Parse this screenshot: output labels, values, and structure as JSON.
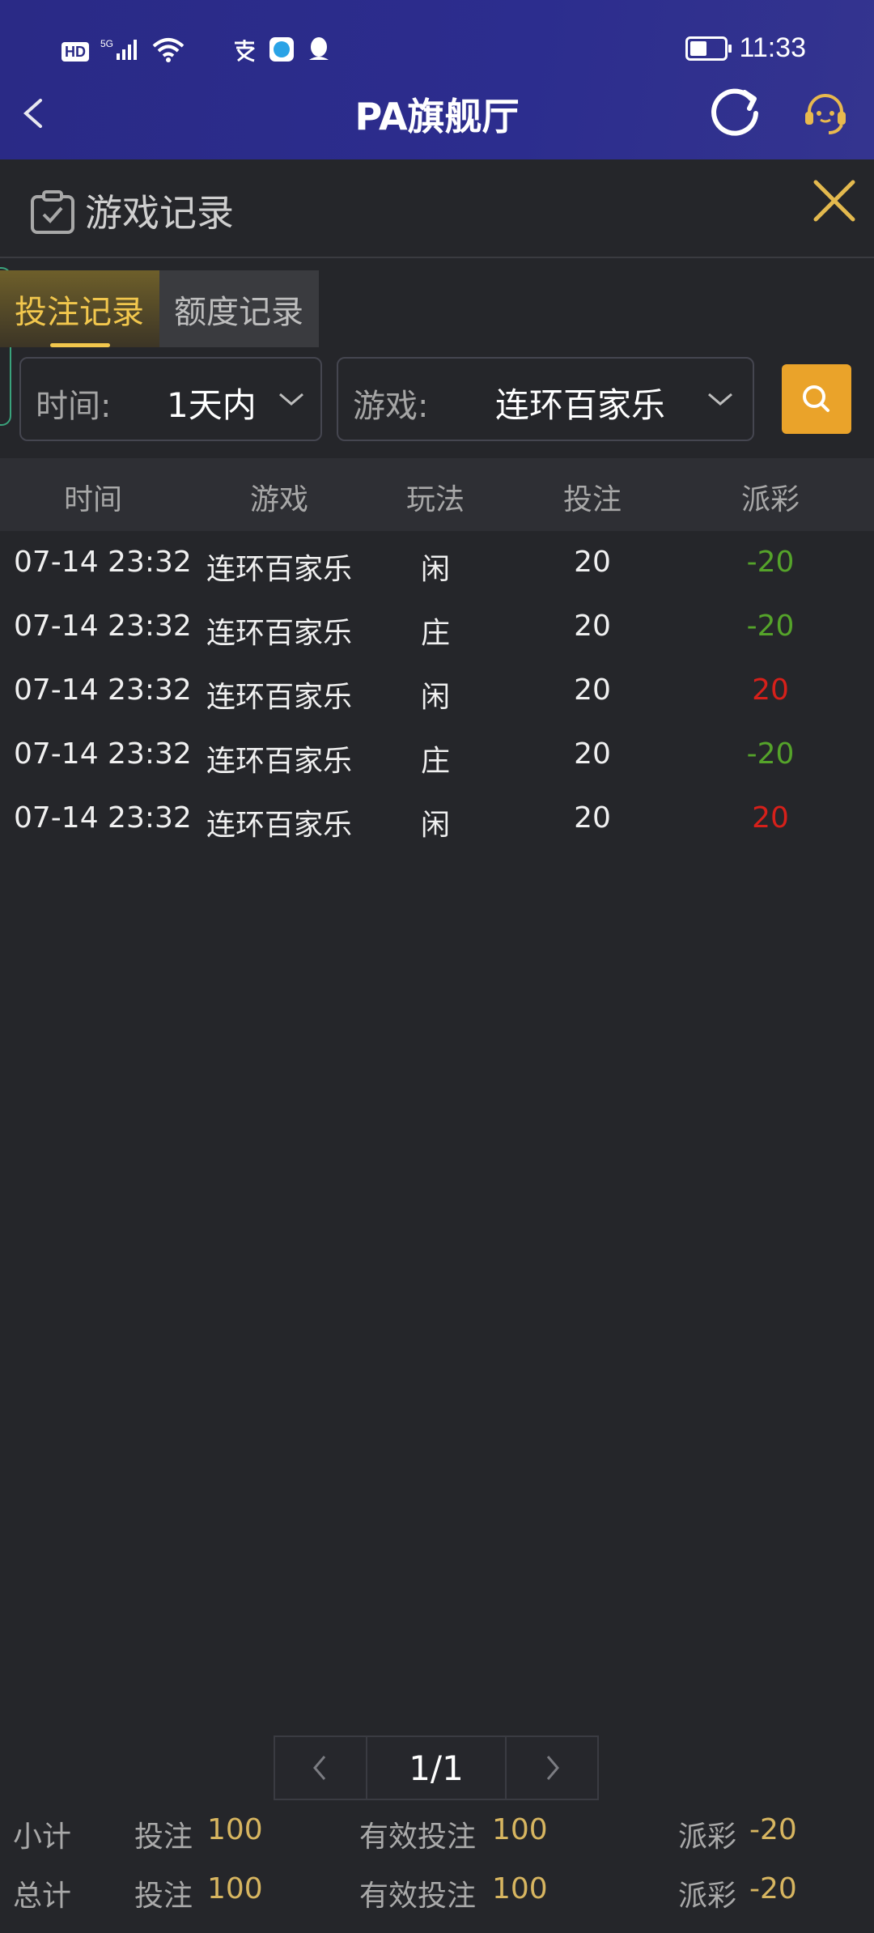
{
  "status_bar": {
    "hd": "HD",
    "network": "5G",
    "time": "11:33"
  },
  "header": {
    "title": "PA旗舰厅"
  },
  "panel": {
    "title": "游戏记录"
  },
  "tabs": [
    {
      "label": "投注记录",
      "active": true
    },
    {
      "label": "额度记录",
      "active": false
    }
  ],
  "filters": {
    "time_label": "时间:",
    "time_value": "1天内",
    "game_label": "游戏:",
    "game_value": "连环百家乐"
  },
  "table": {
    "headers": [
      "时间",
      "游戏",
      "玩法",
      "投注",
      "派彩"
    ],
    "rows": [
      [
        "07-14 23:32",
        "连环百家乐",
        "闲",
        "20",
        "-20"
      ],
      [
        "07-14 23:32",
        "连环百家乐",
        "庄",
        "20",
        "-20"
      ],
      [
        "07-14 23:32",
        "连环百家乐",
        "闲",
        "20",
        "20"
      ],
      [
        "07-14 23:32",
        "连环百家乐",
        "庄",
        "20",
        "-20"
      ],
      [
        "07-14 23:32",
        "连环百家乐",
        "闲",
        "20",
        "20"
      ]
    ]
  },
  "pager": {
    "page": "1/1"
  },
  "summary": [
    {
      "label": "小计",
      "bet_label": "投注",
      "bet": "100",
      "valid_label": "有效投注",
      "valid": "100",
      "payout_label": "派彩",
      "payout": "-20"
    },
    {
      "label": "总计",
      "bet_label": "投注",
      "bet": "100",
      "valid_label": "有效投注",
      "valid": "100",
      "payout_label": "派彩",
      "payout": "-20"
    }
  ],
  "colors": {
    "accent": "#f2c74d",
    "header_bg": "#2a2a86",
    "loss": "#55a32a",
    "win": "#d6201a"
  }
}
